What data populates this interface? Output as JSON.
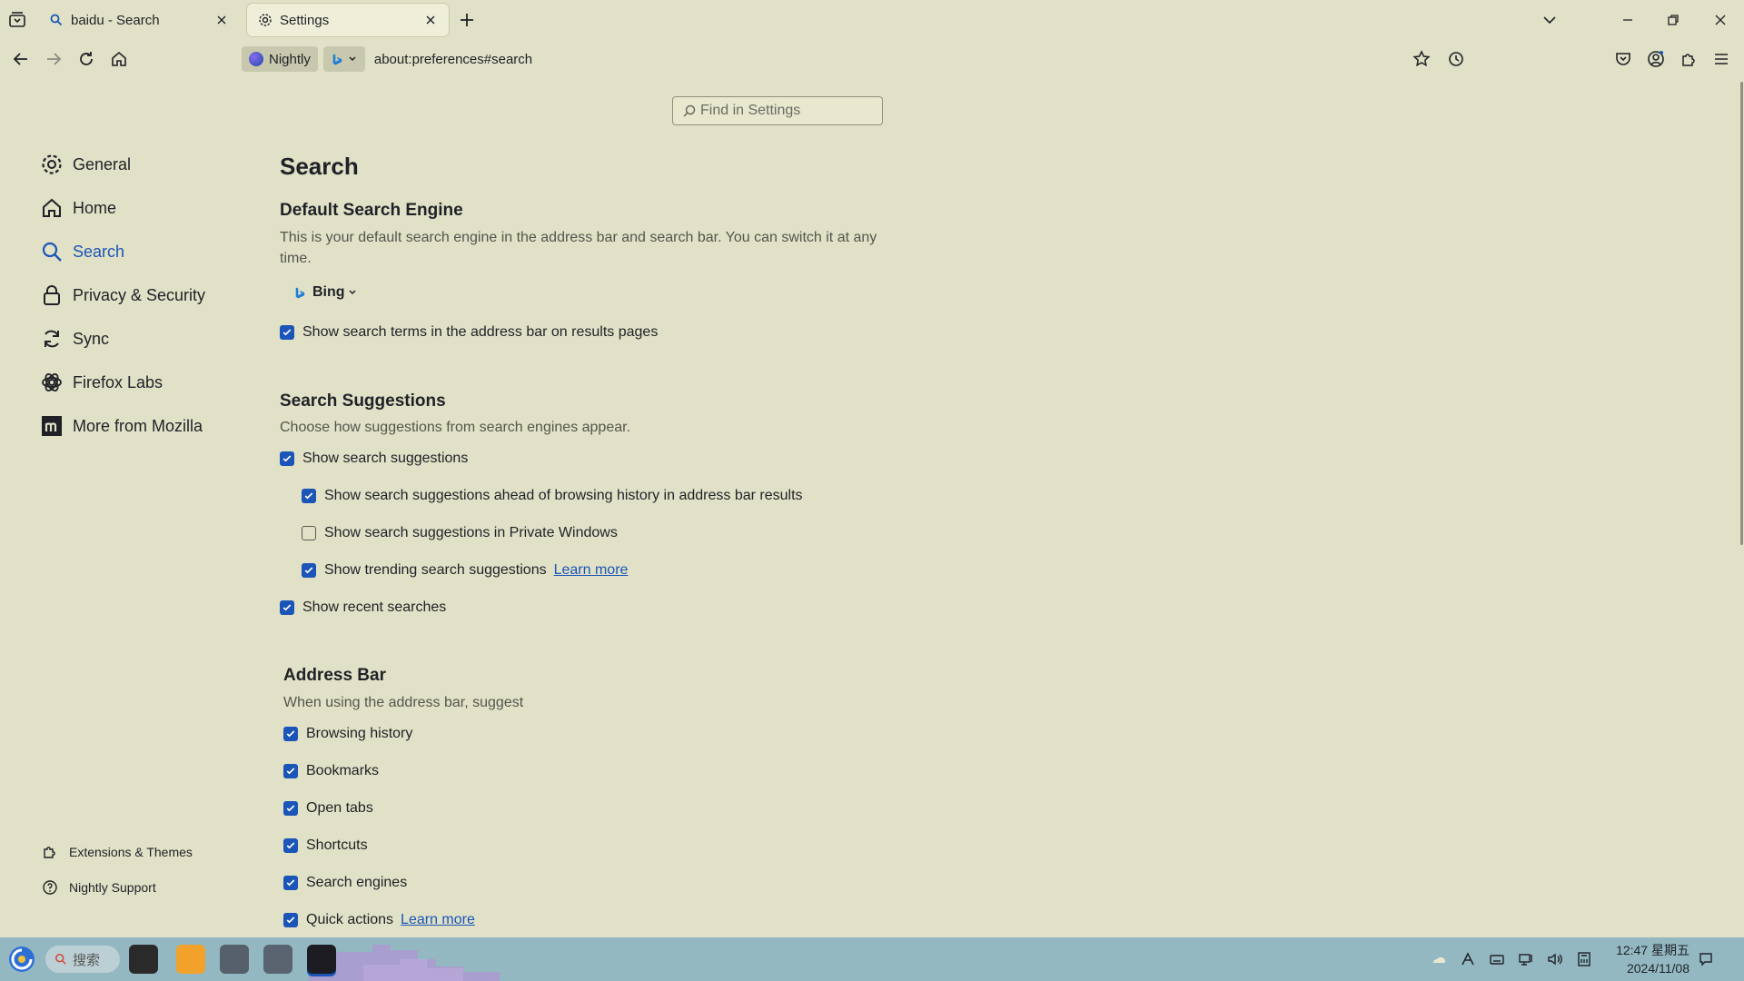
{
  "tabs": [
    {
      "title": "baidu - Search",
      "icon": "search-icon"
    },
    {
      "title": "Settings",
      "icon": "gear-icon",
      "active": true
    }
  ],
  "navbar": {
    "identity_label": "Nightly",
    "search_engine_icon": "bing-icon",
    "url": "about:preferences#search"
  },
  "find": {
    "placeholder": "Find in Settings"
  },
  "sidebar": {
    "items": [
      {
        "label": "General",
        "icon": "gear-icon"
      },
      {
        "label": "Home",
        "icon": "home-icon"
      },
      {
        "label": "Search",
        "icon": "search-icon",
        "active": true
      },
      {
        "label": "Privacy & Security",
        "icon": "lock-icon"
      },
      {
        "label": "Sync",
        "icon": "sync-icon"
      },
      {
        "label": "Firefox Labs",
        "icon": "labs-icon"
      },
      {
        "label": "More from Mozilla",
        "icon": "mozilla-icon"
      }
    ],
    "footer": [
      {
        "label": "Extensions & Themes",
        "icon": "puzzle-icon"
      },
      {
        "label": "Nightly Support",
        "icon": "help-icon"
      }
    ]
  },
  "main": {
    "title": "Search",
    "default_engine": {
      "heading": "Default Search Engine",
      "description": "This is your default search engine in the address bar and search bar. You can switch it at any time.",
      "engine": "Bing",
      "show_terms": {
        "label": "Show search terms in the address bar on results pages",
        "checked": true
      }
    },
    "suggestions": {
      "heading": "Search Suggestions",
      "description": "Choose how suggestions from search engines appear.",
      "show_suggestions": {
        "label": "Show search suggestions",
        "checked": true
      },
      "ahead_history": {
        "label": "Show search suggestions ahead of browsing history in address bar results",
        "checked": true
      },
      "private_windows": {
        "label": "Show search suggestions in Private Windows",
        "checked": false
      },
      "trending": {
        "label": "Show trending search suggestions",
        "checked": true,
        "link": "Learn more"
      },
      "recent": {
        "label": "Show recent searches",
        "checked": true
      }
    },
    "address_bar": {
      "heading": "Address Bar",
      "description": "When using the address bar, suggest",
      "options": [
        {
          "label": "Browsing history",
          "checked": true
        },
        {
          "label": "Bookmarks",
          "checked": true
        },
        {
          "label": "Open tabs",
          "checked": true
        },
        {
          "label": "Shortcuts",
          "checked": true
        },
        {
          "label": "Search engines",
          "checked": true
        },
        {
          "label": "Quick actions",
          "checked": true
        }
      ],
      "quick_actions_link": "Learn more"
    }
  },
  "taskbar": {
    "search_label": "搜索",
    "time": "12:47 星期五",
    "date": "2024/11/08"
  },
  "colors": {
    "background": "#e1e1c7",
    "accent": "#1a55b7",
    "taskbar": "#93b8c2"
  }
}
